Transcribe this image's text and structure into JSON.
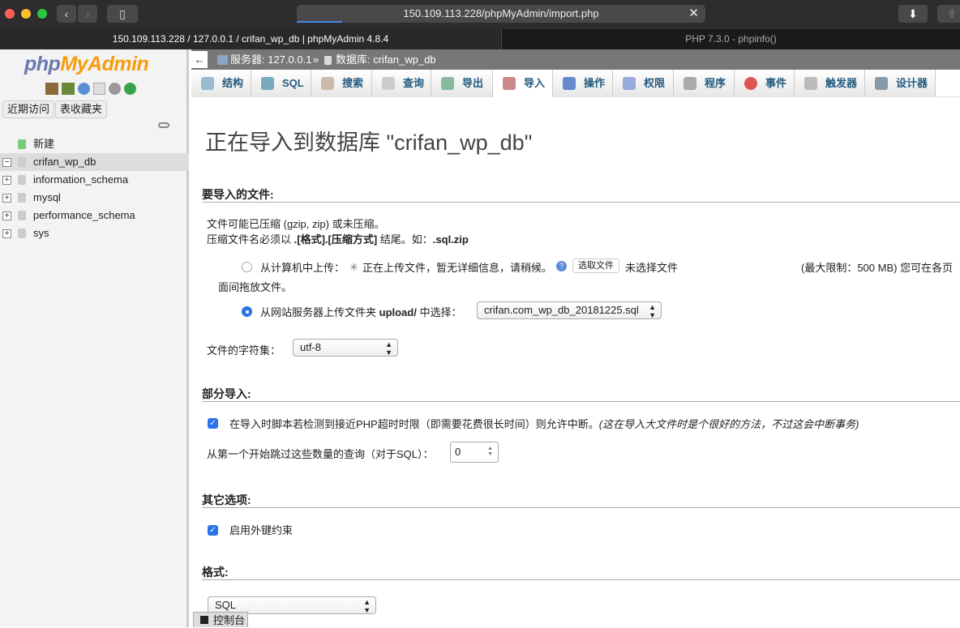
{
  "browser": {
    "url": "150.109.113.228/phpMyAdmin/import.php",
    "tabs": [
      "150.109.113.228 / 127.0.0.1 / crifan_wp_db | phpMyAdmin 4.8.4",
      "PHP 7.3.0 - phpinfo()"
    ]
  },
  "sidebar": {
    "logo_php": "php",
    "logo_my": "MyAdmin",
    "recent": "近期访问",
    "favorites": "表收藏夹",
    "tree": [
      "新建",
      "crifan_wp_db",
      "information_schema",
      "mysql",
      "performance_schema",
      "sys"
    ]
  },
  "breadcrumb": {
    "back": "←",
    "server": "服务器: 127.0.0.1",
    "sep": "»",
    "database": "数据库: crifan_wp_db"
  },
  "tabs": [
    "结构",
    "SQL",
    "搜索",
    "查询",
    "导出",
    "导入",
    "操作",
    "权限",
    "程序",
    "事件",
    "触发器",
    "设计器"
  ],
  "colors": {
    "accent": "#235a81",
    "radio": "#2a73e8"
  },
  "main": {
    "title": "正在导入到数据库 \"crifan_wp_db\"",
    "file_section": "要导入的文件:",
    "compress_note": "文件可能已压缩 (gzip, zip) 或未压缩。",
    "compress_note2_pre": "压缩文件名必须以 ",
    "compress_note2_bold": ".[格式].[压缩方式]",
    "compress_note2_mid": " 结尾。如：",
    "compress_note2_ex": ".sql.zip",
    "upload_local": "从计算机中上传：",
    "uploading": "正在上传文件，暂无详细信息，请稍候。",
    "choose_file": "选取文件",
    "no_file": "未选择文件",
    "max_limit": "(最大限制：500 MB) 您可在各页",
    "drag_note": "面间拖放文件。",
    "upload_server_pre": "从网站服务器上传文件夹 ",
    "upload_server_dir": "upload/",
    "upload_server_post": " 中选择：",
    "server_file": "crifan.com_wp_db_20181225.sql",
    "charset_label": "文件的字符集：",
    "charset": "utf-8",
    "partial_section": "部分导入:",
    "allow_interrupt": "在导入时脚本若检测到接近PHP超时时限（即需要花费很长时间）则允许中断。",
    "allow_interrupt_note": "(这在导入大文件时是个很好的方法，不过这会中断事务)",
    "skip_label": "从第一个开始跳过这些数量的查询（对于SQL）：",
    "skip_value": "0",
    "other_section": "其它选项:",
    "fk": "启用外键约束",
    "format_section": "格式:",
    "format": "SQL",
    "console": "控制台"
  }
}
